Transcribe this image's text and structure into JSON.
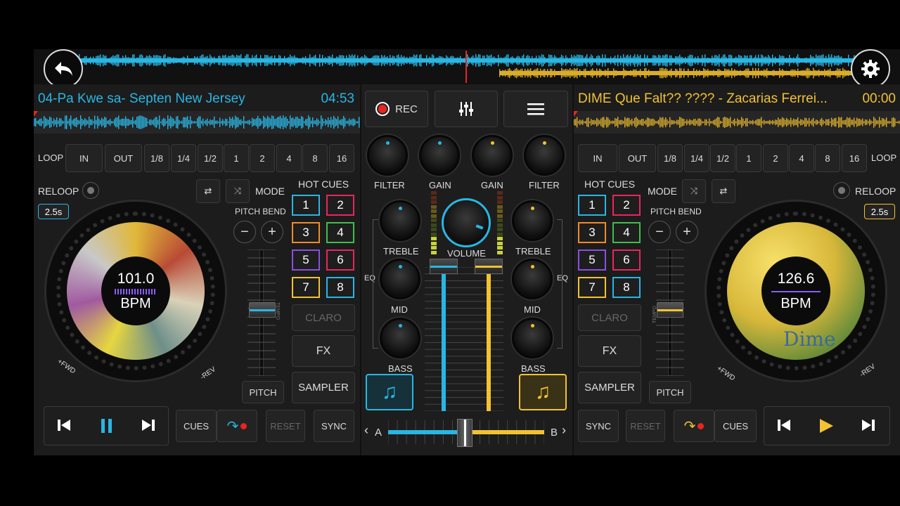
{
  "colors": {
    "left": "#29b6e3",
    "right": "#f2c233",
    "rec": "#e8261f",
    "bg": "#1b1b1b"
  },
  "top": {
    "back_icon": "back-arrow-icon",
    "settings_icon": "gear-icon"
  },
  "left": {
    "title": "04-Pa Kwe sa- Septen New Jersey",
    "time": "04:53",
    "loop_label": "LOOP",
    "in": "IN",
    "out": "OUT",
    "loop_sizes": [
      "1/8",
      "1/4",
      "1/2",
      "1",
      "2",
      "4",
      "8",
      "16"
    ],
    "reloop": "RELOOP",
    "reloop_time": "2.5s",
    "mode": "MODE",
    "pitch_bend": "PITCH BEND",
    "minus": "−",
    "plus": "+",
    "tempo": "TEMPO",
    "pitch": "PITCH",
    "hot_cues_title": "HOT CUES",
    "hot_cues": [
      "1",
      "2",
      "3",
      "4",
      "5",
      "6",
      "7",
      "8"
    ],
    "claro": "CLARO",
    "fx": "FX",
    "sampler": "SAMPLER",
    "bpm_value": "101.0",
    "bpm_label": "BPM",
    "fwd": "+FWD",
    "rev": "-REV",
    "cues": "CUES",
    "reset": "RESET",
    "sync": "SYNC"
  },
  "right": {
    "title": "DIME Que Falt?? ???? - Zacarias Ferrei...",
    "time": "00:00",
    "loop_label": "LOOP",
    "in": "IN",
    "out": "OUT",
    "loop_sizes": [
      "1/8",
      "1/4",
      "1/2",
      "1",
      "2",
      "4",
      "8",
      "16"
    ],
    "reloop": "RELOOP",
    "reloop_time": "2.5s",
    "mode": "MODE",
    "pitch_bend": "PITCH BEND",
    "minus": "−",
    "plus": "+",
    "tempo": "TEMPO",
    "pitch": "PITCH",
    "hot_cues_title": "HOT CUES",
    "hot_cues": [
      "1",
      "2",
      "3",
      "4",
      "5",
      "6",
      "7",
      "8"
    ],
    "claro": "CLARO",
    "fx": "FX",
    "sampler": "SAMPLER",
    "bpm_value": "126.6",
    "bpm_label": "BPM",
    "art_text": "Dime",
    "fwd": "+FWD",
    "rev": "-REV",
    "cues": "CUES",
    "reset": "RESET",
    "sync": "SYNC"
  },
  "mixer": {
    "rec": "REC",
    "filter_l": "FILTER",
    "gain_l": "GAIN",
    "gain_r": "GAIN",
    "filter_r": "FILTER",
    "treble_l": "TREBLE",
    "treble_r": "TREBLE",
    "volume": "VOLUME",
    "eq_l": "EQ",
    "eq_r": "EQ",
    "mid_l": "MID",
    "mid_r": "MID",
    "bass_l": "BASS",
    "bass_r": "BASS",
    "a": "A",
    "b": "B",
    "prev": "‹",
    "next": "›"
  }
}
